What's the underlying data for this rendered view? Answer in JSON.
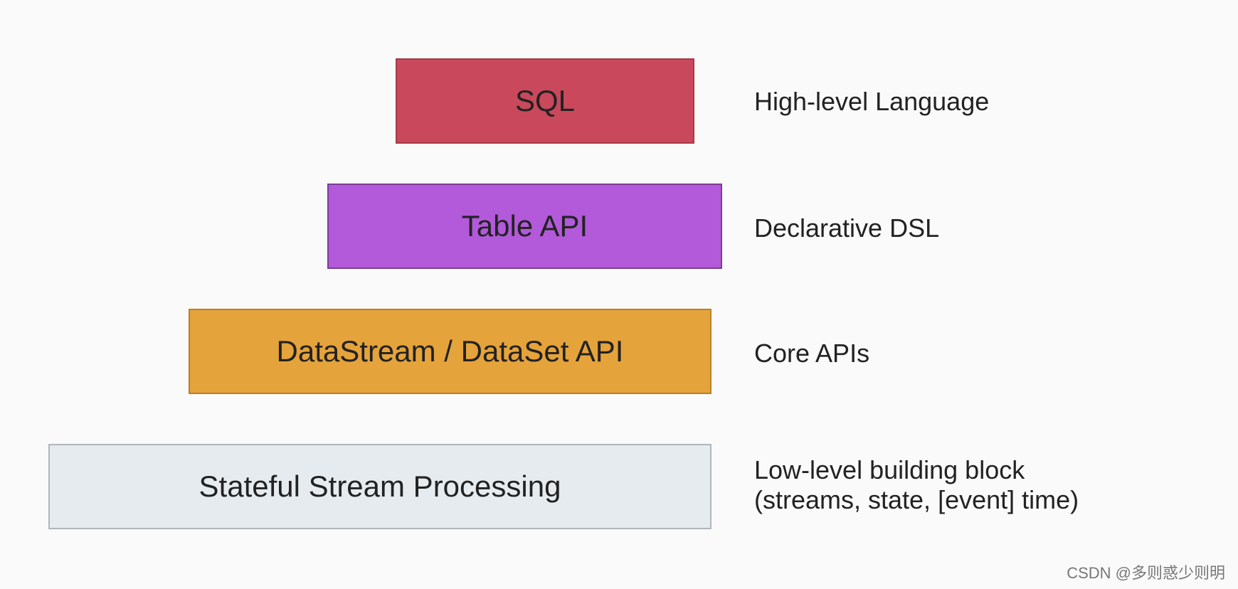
{
  "layers": {
    "sql": {
      "label": "SQL",
      "caption": "High-level Language"
    },
    "table": {
      "label": "Table API",
      "caption": "Declarative DSL"
    },
    "ds": {
      "label": "DataStream / DataSet API",
      "caption": "Core APIs"
    },
    "state": {
      "label": "Stateful Stream Processing",
      "caption": "Low-level building block\n(streams, state, [event] time)"
    }
  },
  "watermark": "CSDN @多则惑少则明"
}
